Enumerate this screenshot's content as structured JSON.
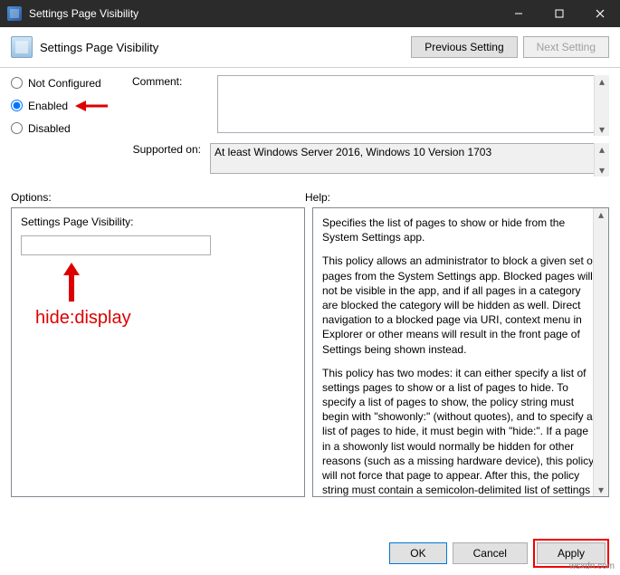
{
  "window": {
    "title": "Settings Page Visibility"
  },
  "header": {
    "name": "Settings Page Visibility",
    "btn_prev": "Previous Setting",
    "btn_next": "Next Setting"
  },
  "radios": {
    "not_configured": "Not Configured",
    "enabled": "Enabled",
    "disabled": "Disabled",
    "selected": "enabled"
  },
  "labels": {
    "comment": "Comment:",
    "supported": "Supported on:",
    "options": "Options:",
    "help": "Help:"
  },
  "supported_value": "At least Windows Server 2016, Windows 10 Version 1703",
  "options_panel": {
    "field_label": "Settings Page Visibility:",
    "field_value": "",
    "annotation": "hide:display"
  },
  "help_panel": {
    "p1": "Specifies the list of pages to show or hide from the System Settings app.",
    "p2": "This policy allows an administrator to block a given set of pages from the System Settings app. Blocked pages will not be visible in the app, and if all pages in a category are blocked the category will be hidden as well. Direct navigation to a blocked page via URI, context menu in Explorer or other means will result in the front page of Settings being shown instead.",
    "p3": "This policy has two modes: it can either specify a list of settings pages to show or a list of pages to hide. To specify a list of pages to show, the policy string must begin with \"showonly:\" (without quotes), and to specify a list of pages to hide, it must begin with \"hide:\". If a page in a showonly list would normally be hidden for other reasons (such as a missing hardware device), this policy will not force that page to appear. After this, the policy string must contain a semicolon-delimited list of settings page identifiers. The identifier for any given settings page is the published URI for that page, minus the \"ms-settings:\" protocol part."
  },
  "footer": {
    "ok": "OK",
    "cancel": "Cancel",
    "apply": "Apply"
  },
  "watermark": "wsxdn.com"
}
